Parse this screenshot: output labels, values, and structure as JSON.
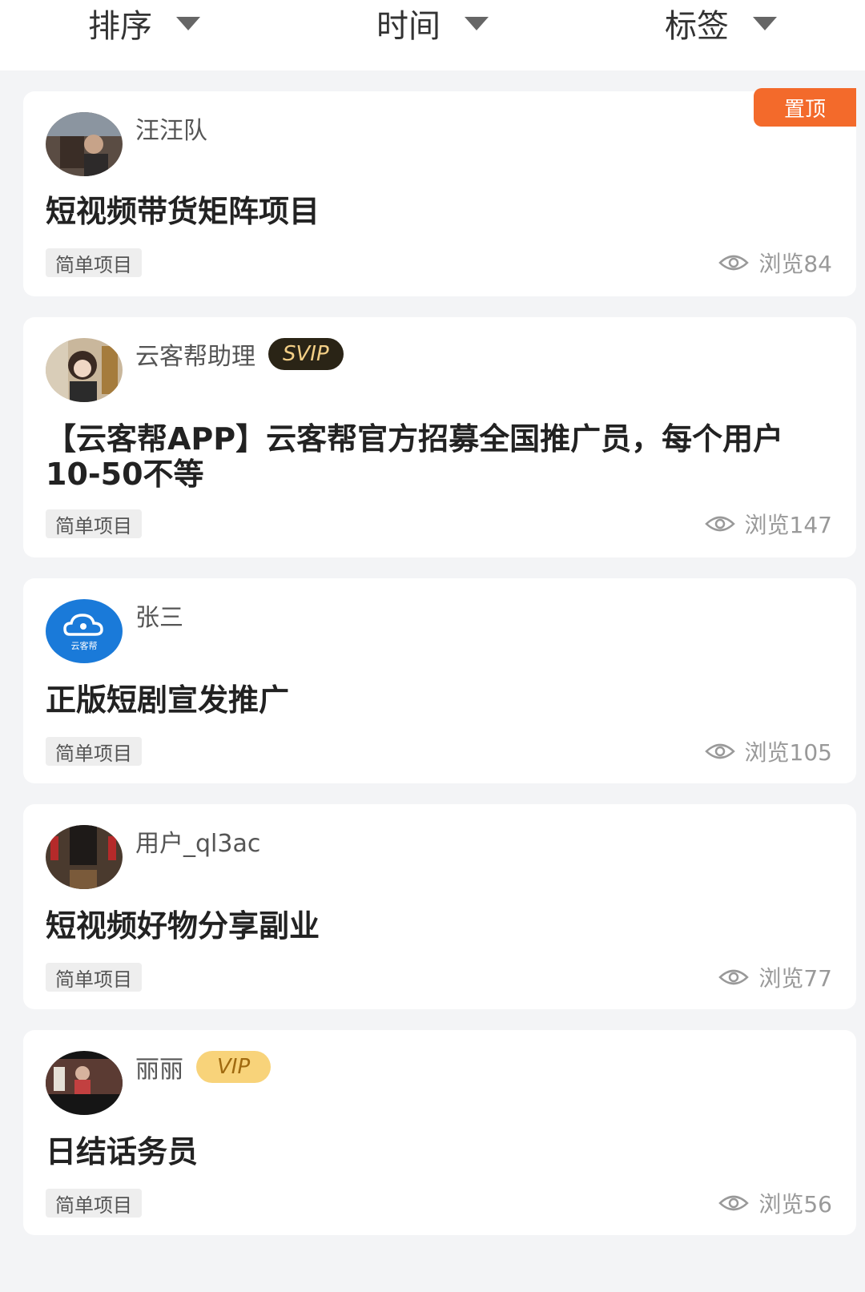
{
  "filters": [
    {
      "label": "排序"
    },
    {
      "label": "时间"
    },
    {
      "label": "标签"
    }
  ],
  "posts": [
    {
      "author": "汪汪队",
      "pinned": "置顶",
      "title": "短视频带货矩阵项目",
      "tag": "简单项目",
      "views": "浏览84"
    },
    {
      "author": "云客帮助理",
      "badge": "SVIP",
      "title": "【云客帮APP】云客帮官方招募全国推广员，每个用户10-50不等",
      "tag": "简单项目",
      "views": "浏览147"
    },
    {
      "author": "张三",
      "avatar_text": "云客帮",
      "title": "正版短剧宣发推广",
      "tag": "简单项目",
      "views": "浏览105"
    },
    {
      "author": "用户_ql3ac",
      "title": "短视频好物分享副业",
      "tag": "简单项目",
      "views": "浏览77"
    },
    {
      "author": "丽丽",
      "badge": "VIP",
      "title": "日结话务员",
      "tag": "简单项目",
      "views": "浏览56"
    }
  ],
  "colors": {
    "pin": "#f36a2b",
    "svip_bg": "#2a2416",
    "vip_bg": "#f8d37a",
    "brand_blue": "#1a7ad9"
  }
}
